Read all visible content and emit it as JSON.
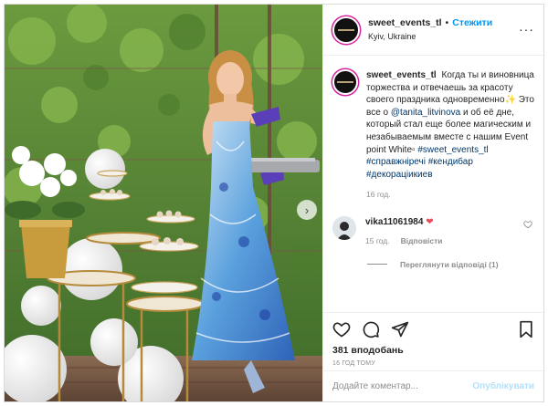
{
  "post": {
    "username": "sweet_events_tl",
    "follow_label": "Стежити",
    "location": "Kyiv, Ukraine",
    "more_icon": "more-options-icon"
  },
  "caption": {
    "username": "sweet_events_tl",
    "text_1": "Когда ты и виновница торжества и отвечаешь за красоту своего праздника одновременно",
    "sparkle": "✨",
    "text_2": " Это все о ",
    "mention": "@tanita_litvinova",
    "text_3": " и об её дне, который стал еще более магическим и незабываемым вместе с нашим Event point White",
    "text_end": "▫",
    "hashtags": [
      "#sweet_events_tl",
      "#справжнiречi",
      "#кендибар",
      "#декорацiикиев"
    ],
    "time": "16 год."
  },
  "comment": {
    "username": "vika11061984",
    "text": "❤",
    "time": "15 год.",
    "reply_label": "Відповісти",
    "view_replies": "Переглянути відповіді (1)"
  },
  "actions": {
    "likes": "381 вподобань",
    "timestamp": "16 ГОД ТОМУ"
  },
  "add_comment": {
    "placeholder": "Додайте коментар...",
    "emoji_icon": "smile-icon",
    "publish_label": "Опублікувати"
  },
  "colors": {
    "link_blue": "#0095f6",
    "hashtag_blue": "#00376b",
    "heart_red": "#ed4956",
    "muted": "#8e8e8e"
  }
}
